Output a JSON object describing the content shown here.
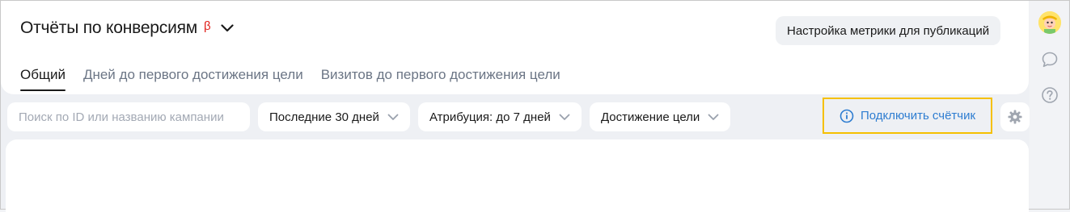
{
  "header": {
    "title": "Отчёты по конверсиям",
    "beta_mark": "β",
    "settings_button": "Настройка метрики для публикаций"
  },
  "tabs": [
    {
      "label": "Общий",
      "active": true
    },
    {
      "label": "Дней до первого достижения цели",
      "active": false
    },
    {
      "label": "Визитов до первого достижения цели",
      "active": false
    }
  ],
  "filters": {
    "search_placeholder": "Поиск по ID или названию кампании",
    "search_value": "",
    "period": "Последние 30 дней",
    "attribution": "Атрибуция: до 7 дней",
    "goal": "Достижение цели"
  },
  "connect_counter": "Подключить счётчик",
  "icons": {
    "title_chevron": "chevron-down-icon",
    "info": "info-icon",
    "settings": "gear-icon",
    "chat": "chat-icon",
    "help": "help-icon",
    "avatar": "avatar"
  },
  "colors": {
    "beta": "#e0201b",
    "link": "#2e7dd1",
    "highlight_border": "#f5c000",
    "page_bg": "#eef0f4"
  }
}
